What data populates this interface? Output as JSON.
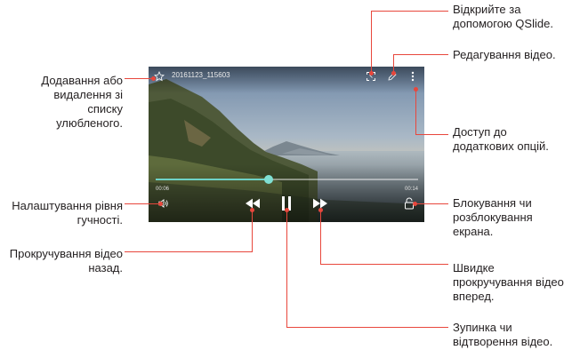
{
  "video": {
    "filename": "20161123_115603",
    "time_elapsed": "00:06",
    "time_total": "00:14",
    "progress": 0.43,
    "accent_color": "#6ed3c8"
  },
  "callouts": {
    "favorite": "Додавання або видалення зі списку улюбленого.",
    "volume": "Налаштування рівня гучності.",
    "rewind": "Прокручування відео назад.",
    "qslide": "Відкрийте за допомогою QSlide.",
    "edit": "Редагування відео.",
    "more_options": "Доступ до додаткових опцій.",
    "lock": "Блокування чи розблокування екрана.",
    "fast_forward": "Швидке прокручування відео вперед.",
    "pause": "Зупинка чи відтворення відео."
  },
  "colors": {
    "callout_line": "#e8473c"
  },
  "icons": [
    "star-icon",
    "qslide-icon",
    "pencil-icon",
    "more-vertical-icon",
    "volume-icon",
    "rewind-icon",
    "pause-icon",
    "fast-forward-icon",
    "lock-icon"
  ]
}
